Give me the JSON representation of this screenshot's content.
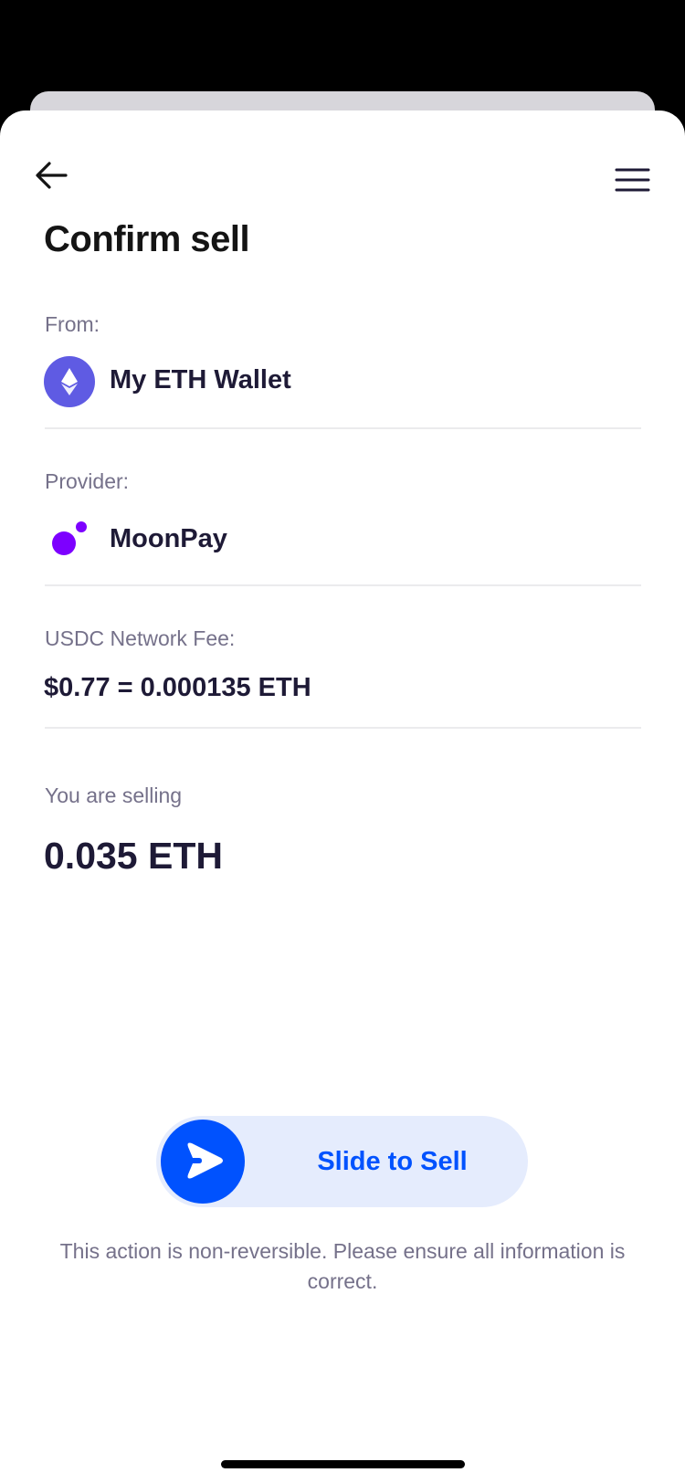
{
  "header": {
    "title": "Confirm sell",
    "back_icon": "arrow-left-icon",
    "menu_icon": "hamburger-menu-icon"
  },
  "from": {
    "label": "From:",
    "wallet_name": "My ETH Wallet",
    "icon": "ethereum-icon",
    "icon_color": "#5f5be3"
  },
  "provider": {
    "label": "Provider:",
    "name": "MoonPay",
    "icon": "moonpay-icon",
    "icon_color": "#7d00ff"
  },
  "fee": {
    "label": "USDC Network Fee:",
    "value": "$0.77 = 0.000135 ETH"
  },
  "selling": {
    "label": "You are selling",
    "amount": "0.035 ETH"
  },
  "slider": {
    "label": "Slide to Sell",
    "icon": "send-arrow-icon",
    "accent": "#0052fe"
  },
  "disclaimer": "This action is non-reversible. Please ensure all information is correct."
}
